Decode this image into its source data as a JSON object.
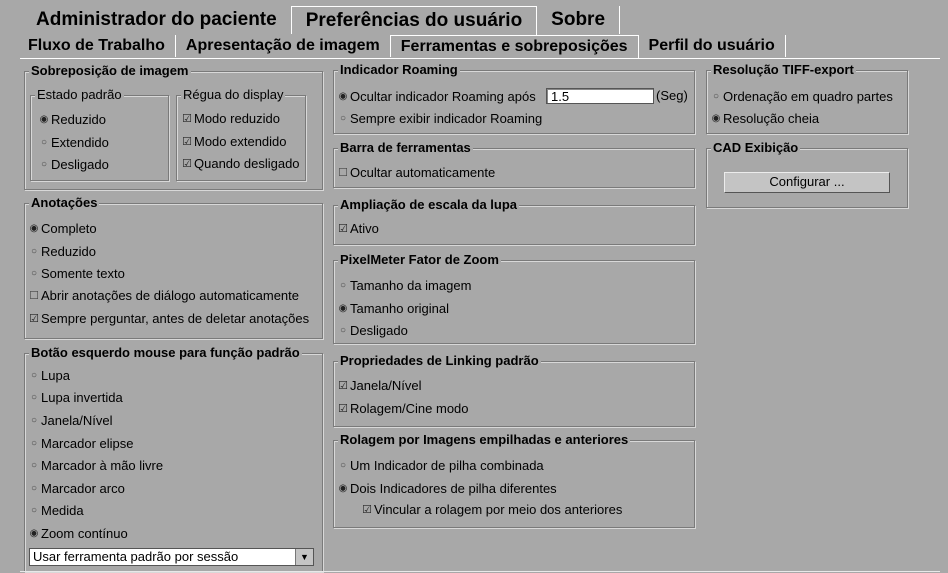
{
  "tabs_top": [
    "Administrador do paciente",
    "Preferências do usuário",
    "Sobre"
  ],
  "tabs_sub": [
    "Fluxo de Trabalho",
    "Apresentação de imagem",
    "Ferramentas e sobreposições",
    "Perfil do usuário"
  ],
  "sobreposicao": {
    "title": "Sobreposição de imagem",
    "estado_title": "Estado padrão",
    "estado": [
      "Reduzido",
      "Extendido",
      "Desligado"
    ],
    "regua_title": "Régua do display",
    "regua": [
      "Modo reduzido",
      "Modo extendido",
      "Quando desligado"
    ]
  },
  "anotacoes": {
    "title": "Anotações",
    "options": [
      "Completo",
      "Reduzido",
      "Somente texto"
    ],
    "checks": [
      "Abrir anotações de diálogo automaticamente",
      "Sempre perguntar, antes de deletar anotações"
    ]
  },
  "botao": {
    "title": "Botão esquerdo mouse para função padrão",
    "options": [
      "Lupa",
      "Lupa invertida",
      "Janela/Nível",
      "Marcador elipse",
      "Marcador à mão livre",
      "Marcador arco",
      "Medida",
      "Zoom contínuo"
    ],
    "select_value": "Usar ferramenta padrão por sessão"
  },
  "roaming": {
    "title": "Indicador Roaming",
    "opt1": "Ocultar indicador Roaming após",
    "value": "1.5",
    "unit": "(Seg)",
    "opt2": "Sempre exibir indicador Roaming"
  },
  "barra": {
    "title": "Barra de ferramentas",
    "check": "Ocultar automaticamente"
  },
  "lupa": {
    "title": "Ampliação de escala da lupa",
    "check": "Ativo"
  },
  "pixelmeter": {
    "title": "PixelMeter Fator de Zoom",
    "options": [
      "Tamanho da imagem",
      "Tamanho original",
      "Desligado"
    ]
  },
  "linking": {
    "title": "Propriedades de Linking padrão",
    "checks": [
      "Janela/Nível",
      "Rolagem/Cine modo"
    ]
  },
  "rolagem": {
    "title": "Rolagem por Imagens empilhadas e anteriores",
    "options": [
      "Um Indicador de pilha combinada",
      "Dois Indicadores de pilha diferentes"
    ],
    "check": "Vincular a rolagem por meio dos anteriores"
  },
  "tiff": {
    "title": "Resolução TIFF-export",
    "options": [
      "Ordenação em quadro partes",
      "Resolução cheia"
    ]
  },
  "cad": {
    "title": "CAD Exibição",
    "button": "Configurar ..."
  },
  "icons": {
    "radio": "radio-button-icon",
    "check": "checkbox-icon",
    "dropdown": "chevron-down-icon"
  }
}
